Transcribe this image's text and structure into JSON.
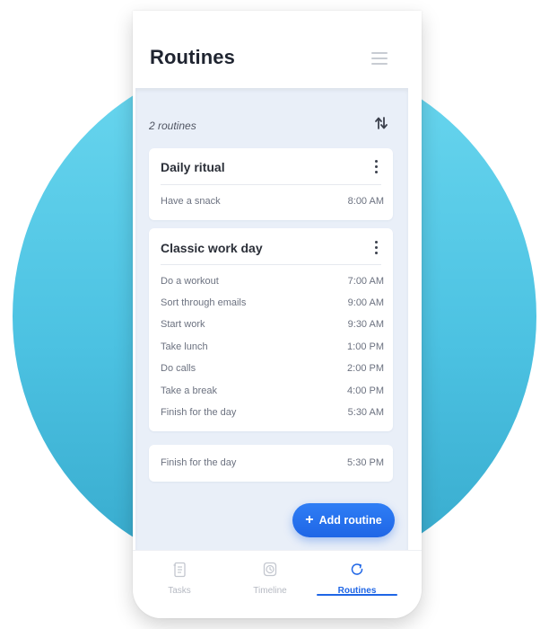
{
  "header": {
    "title": "Routines"
  },
  "summary": {
    "count_text": "2 routines"
  },
  "routines": [
    {
      "title": "Daily ritual",
      "items": [
        {
          "name": "Have a snack",
          "time": "8:00 AM"
        }
      ]
    },
    {
      "title": "Classic work day",
      "items": [
        {
          "name": "Do a workout",
          "time": "7:00 AM"
        },
        {
          "name": "Sort through emails",
          "time": "9:00 AM"
        },
        {
          "name": "Start work",
          "time": "9:30 AM"
        },
        {
          "name": "Take lunch",
          "time": "1:00 PM"
        },
        {
          "name": "Do calls",
          "time": "2:00 PM"
        },
        {
          "name": "Take a break",
          "time": "4:00 PM"
        },
        {
          "name": "Finish for the day",
          "time": "5:30 AM"
        }
      ]
    }
  ],
  "extra_card": {
    "items": [
      {
        "name": "Finish for the day",
        "time": "5:30 PM"
      }
    ]
  },
  "add_button": {
    "label": "Add routine",
    "icon": "plus-icon"
  },
  "tabs": [
    {
      "label": "Tasks",
      "icon": "tasks-icon",
      "active": false
    },
    {
      "label": "Timeline",
      "icon": "timeline-icon",
      "active": false
    },
    {
      "label": "Routines",
      "icon": "routines-icon",
      "active": true
    }
  ],
  "colors": {
    "accent": "#1f66e6",
    "background_circle": "#4cc2e2",
    "content_background": "#e9eff8"
  }
}
